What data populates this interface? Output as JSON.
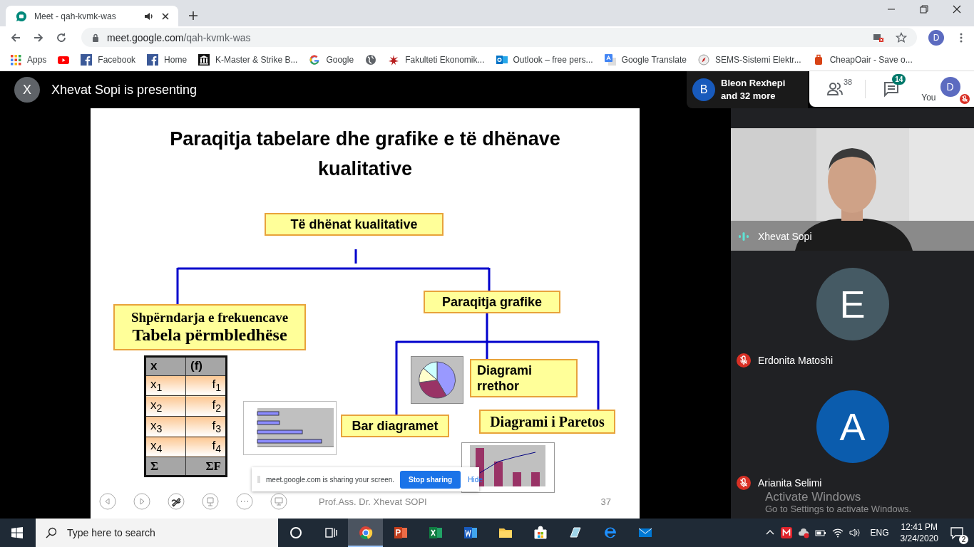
{
  "browser": {
    "tab": {
      "title": "Meet - qah-kvmk-was",
      "audio": true
    },
    "address": {
      "host": "meet.google.com",
      "path": "/qah-kvmk-was"
    },
    "profile_initial": "D",
    "bookmarks": [
      {
        "kind": "apps",
        "label": "Apps"
      },
      {
        "kind": "youtube"
      },
      {
        "kind": "facebook",
        "label": "Facebook"
      },
      {
        "kind": "facebook",
        "label": "Home"
      },
      {
        "kind": "building",
        "label": "K-Master & Strike B..."
      },
      {
        "kind": "google",
        "label": "Google"
      },
      {
        "kind": "globe"
      },
      {
        "kind": "spark",
        "label": "Fakulteti Ekonomik..."
      },
      {
        "kind": "outlook",
        "label": "Outlook – free pers..."
      },
      {
        "kind": "translate",
        "label": "Google Translate"
      },
      {
        "kind": "compass",
        "label": "SEMS-Sistemi Elektr..."
      },
      {
        "kind": "luggage",
        "label": "CheapOair - Save o..."
      }
    ]
  },
  "meet": {
    "presenter_initial": "X",
    "presenting": "Xhevat Sopi is presenting",
    "chip": {
      "initial": "B",
      "name": "Bleon Rexhepi",
      "more": "and 32 more"
    },
    "people_count": "38",
    "chat_count": "14",
    "you_label": "You",
    "you_initial": "D",
    "you_muted": true
  },
  "slide": {
    "title": "Paraqitja tabelare dhe grafike e të dhënave kualitative",
    "nodes": [
      {
        "lines": [
          "Të dhënat kualitative"
        ]
      },
      {
        "lines": [
          "Paraqitja grafike"
        ]
      },
      {
        "lines": [
          "Shpërndarja e frekuencave",
          "Tabela përmbledhëse"
        ]
      },
      {
        "lines": [
          "Diagrami",
          "rrethor"
        ]
      },
      {
        "lines": [
          "Bar diagramet"
        ]
      },
      {
        "lines": [
          "Diagrami i Paretos"
        ]
      }
    ],
    "table": {
      "header": [
        "x",
        "(f)"
      ],
      "rows": [
        [
          "x$_{1}$",
          "f$_{1}$"
        ],
        [
          "x$_{2}$",
          "f$_{2}$"
        ],
        [
          "x$_{3}$",
          "f$_{3}$"
        ],
        [
          "x$_{4}$",
          "f$_{4}$"
        ]
      ],
      "footer": [
        "Σ",
        "ΣF"
      ]
    },
    "author": "Prof.Ass. Dr. Xhevat SOPI",
    "page": "37"
  },
  "share_bar": {
    "message": "meet.google.com is sharing your screen.",
    "stop": "Stop sharing",
    "hide": "Hide"
  },
  "tiles": [
    {
      "kind": "video",
      "name": "Xhevat Sopi",
      "muted": false
    },
    {
      "kind": "avatar",
      "initial": "E",
      "color": "#455a64",
      "name": "Erdonita Matoshi",
      "muted": true
    },
    {
      "kind": "avatar",
      "initial": "A",
      "color": "#0b5cad",
      "name": "Arianita Selimi",
      "muted": true
    }
  ],
  "activation": {
    "title": "Activate Windows",
    "subtitle": "Go to Settings to activate Windows."
  },
  "taskbar": {
    "search_placeholder": "Type here to search",
    "apps": [
      {
        "kind": "cortana",
        "selected": false
      },
      {
        "kind": "taskview",
        "selected": false
      },
      {
        "kind": "chrome",
        "selected": true
      },
      {
        "kind": "powerpoint",
        "selected": false
      },
      {
        "kind": "excel",
        "selected": false
      },
      {
        "kind": "word",
        "selected": false
      },
      {
        "kind": "explorer",
        "selected": false
      },
      {
        "kind": "store",
        "selected": false
      },
      {
        "kind": "whiteboard",
        "selected": false
      },
      {
        "kind": "edge",
        "selected": false
      },
      {
        "kind": "mail",
        "selected": false
      }
    ],
    "language": "ENG",
    "time": "12:41 PM",
    "date": "3/24/2020",
    "notifications": "2"
  }
}
